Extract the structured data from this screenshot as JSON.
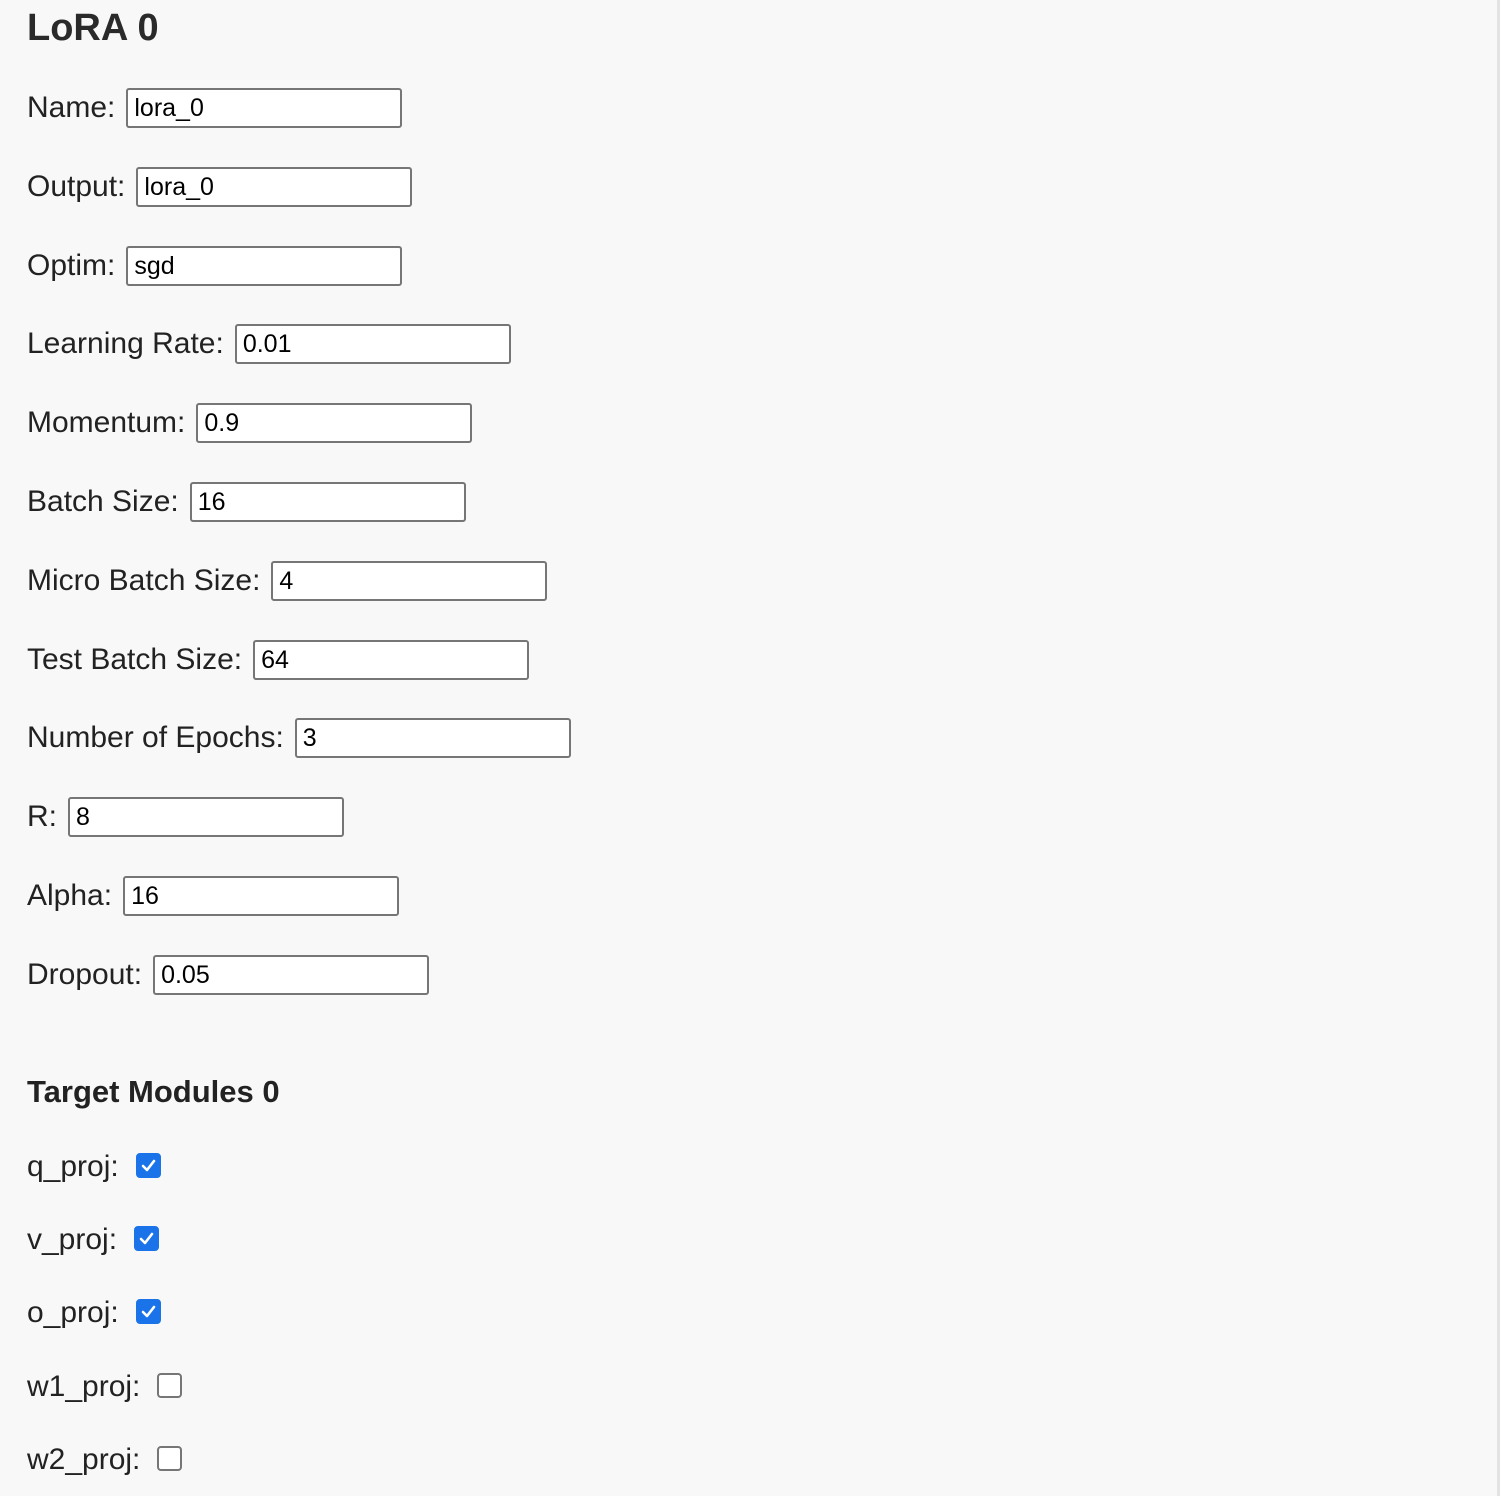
{
  "lora": {
    "title": "LoRA 0",
    "fields": [
      {
        "label": "Name:",
        "value": "lora_0"
      },
      {
        "label": "Output:",
        "value": "lora_0"
      },
      {
        "label": "Optim:",
        "value": "sgd"
      },
      {
        "label": "Learning Rate:",
        "value": "0.01"
      },
      {
        "label": "Momentum:",
        "value": "0.9"
      },
      {
        "label": "Batch Size:",
        "value": "16"
      },
      {
        "label": "Micro Batch Size:",
        "value": "4"
      },
      {
        "label": "Test Batch Size:",
        "value": "64"
      },
      {
        "label": "Number of Epochs:",
        "value": "3"
      },
      {
        "label": "R:",
        "value": "8"
      },
      {
        "label": "Alpha:",
        "value": "16"
      },
      {
        "label": "Dropout:",
        "value": "0.05"
      }
    ]
  },
  "target_modules": {
    "title": "Target Modules 0",
    "items": [
      {
        "label": "q_proj:",
        "checked": true
      },
      {
        "label": "v_proj:",
        "checked": true
      },
      {
        "label": "o_proj:",
        "checked": true
      },
      {
        "label": "w1_proj:",
        "checked": false
      },
      {
        "label": "w2_proj:",
        "checked": false
      }
    ]
  },
  "colors": {
    "background": "#f8f8f8",
    "checkbox_accent": "#1a73e8",
    "input_border": "#767676"
  }
}
